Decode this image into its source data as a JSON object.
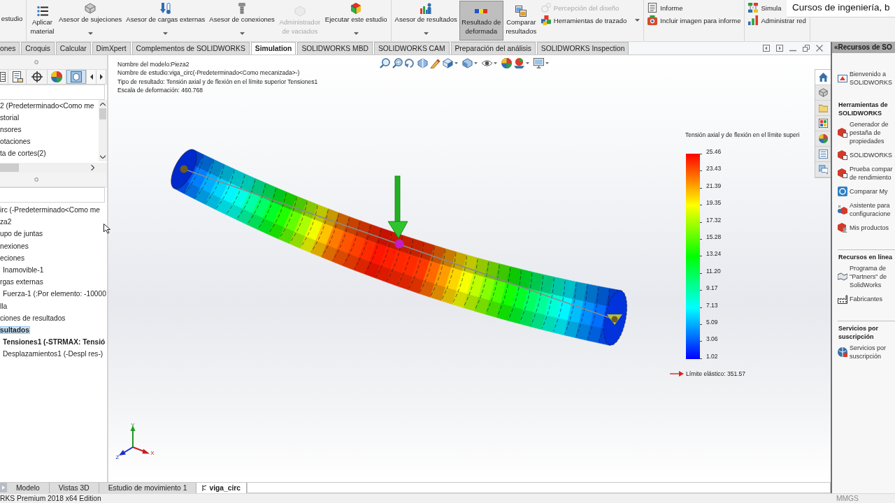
{
  "ribbon": {
    "groups": [
      {
        "items": [
          {
            "kind": "large",
            "label": "estudio",
            "menu": false,
            "selected": false,
            "disabled": false
          }
        ]
      },
      {
        "items": [
          {
            "kind": "large",
            "label": "Aplicar material",
            "menu": false,
            "selected": false,
            "disabled": false
          },
          {
            "kind": "large",
            "label": "Asesor de sujeciones",
            "menu": true,
            "selected": false,
            "disabled": false
          },
          {
            "kind": "large",
            "label": "Asesor de cargas externas",
            "menu": true,
            "selected": false,
            "disabled": false
          },
          {
            "kind": "large",
            "label": "Asesor de conexiones",
            "menu": true,
            "selected": false,
            "disabled": false
          },
          {
            "kind": "large",
            "label": "Administrador de vaciados",
            "menu": false,
            "selected": false,
            "disabled": true
          },
          {
            "kind": "large",
            "label": "Ejecutar este estudio",
            "menu": true,
            "selected": false,
            "disabled": false
          }
        ]
      },
      {
        "items": [
          {
            "kind": "large",
            "label": "Asesor de resultados",
            "menu": true,
            "selected": false,
            "disabled": false
          },
          {
            "kind": "large",
            "label": "Resultado de deformada",
            "menu": false,
            "selected": true,
            "disabled": false
          },
          {
            "kind": "large",
            "label": "Comparar resultados",
            "menu": false,
            "selected": false,
            "disabled": false
          },
          {
            "kind": "small",
            "label": "Percepción del diseño",
            "menu": false,
            "selected": false,
            "disabled": true
          },
          {
            "kind": "small",
            "label": "Herramientas de trazado",
            "menu": true,
            "selected": false,
            "disabled": false
          }
        ]
      },
      {
        "items": [
          {
            "kind": "small",
            "label": "Informe",
            "menu": false,
            "selected": false,
            "disabled": false
          },
          {
            "kind": "small",
            "label": "Incluir imagen para informe",
            "menu": false,
            "selected": false,
            "disabled": false
          }
        ]
      },
      {
        "items": [
          {
            "kind": "small",
            "label": "Simula",
            "menu": false,
            "selected": false,
            "disabled": false
          },
          {
            "kind": "small",
            "label": "Administrar red",
            "menu": false,
            "selected": false,
            "disabled": false
          }
        ]
      }
    ]
  },
  "caption": "Cursos de ingeniería, b",
  "tabs": [
    {
      "label": "ones",
      "selected": false
    },
    {
      "label": "Croquis",
      "selected": false
    },
    {
      "label": "Calcular",
      "selected": false
    },
    {
      "label": "DimXpert",
      "selected": false
    },
    {
      "label": "Complementos de SOLIDWORKS",
      "selected": false
    },
    {
      "label": "Simulation",
      "selected": true
    },
    {
      "label": "SOLIDWORKS MBD",
      "selected": false
    },
    {
      "label": "SOLIDWORKS CAM",
      "selected": false
    },
    {
      "label": "Preparación del análisis",
      "selected": false
    },
    {
      "label": "SOLIDWORKS Inspection",
      "selected": false
    }
  ],
  "feature_panel": {
    "view_tabs": [
      {
        "selected": false
      },
      {
        "selected": false
      },
      {
        "selected": false
      },
      {
        "selected": false
      },
      {
        "selected": true
      }
    ],
    "tree_top": [
      {
        "label": "2 (Predeterminado<Como me",
        "selected": false
      },
      {
        "label": "storial",
        "selected": false
      },
      {
        "label": "nsores",
        "selected": false
      },
      {
        "label": "otaciones",
        "selected": false
      },
      {
        "label": "ta de cortes(2)",
        "selected": false
      }
    ],
    "tree_bottom": [
      {
        "label": "irc (-Predeterminado<Como me",
        "selected": false,
        "active": false
      },
      {
        "label": "za2",
        "selected": false,
        "active": false
      },
      {
        "label": "upo de juntas",
        "selected": false,
        "active": false
      },
      {
        "label": "nexiones",
        "selected": false,
        "active": false
      },
      {
        "label": "eciones",
        "selected": false,
        "active": false,
        "children": [
          {
            "label": "Inamovible-1",
            "selected": false,
            "active": false
          }
        ]
      },
      {
        "label": "rgas externas",
        "selected": false,
        "active": false,
        "children": [
          {
            "label": "Fuerza-1 (:Por elemento: -10000",
            "selected": false,
            "active": false
          }
        ]
      },
      {
        "label": "lla",
        "selected": false,
        "active": false
      },
      {
        "label": "ciones de resultados",
        "selected": false,
        "active": false
      },
      {
        "label": "sultados",
        "selected": true,
        "active": true,
        "children": [
          {
            "label": "Tensiones1 (-STRMAX: Tensió",
            "selected": false,
            "active": true
          },
          {
            "label": "Desplazamientos1 (-Despl res-)",
            "selected": false,
            "active": false
          }
        ]
      }
    ]
  },
  "viewport": {
    "info": [
      "Nombre del modelo:Pieza2",
      "Nombre de estudio:viga_circ(-Predeterminado<Como mecanizada>-)",
      "Tipo de resultado: Tensión axial y de flexión en el límite superior Tensiones1",
      "Escala de deformación: 460.768"
    ],
    "legend": {
      "title": "Tensión axial y de flexión en el límite superi",
      "values": [
        "25.46",
        "23.43",
        "21.39",
        "19.35",
        "17.32",
        "15.28",
        "13.24",
        "11.20",
        "9.17",
        "7.13",
        "5.09",
        "3.06",
        "1.02"
      ],
      "yield_label": "Límite elástico: 351.57"
    },
    "triad": {
      "labels": [
        "Y",
        "X",
        "Z"
      ]
    },
    "task_tabs": [
      {
        "selected": true
      },
      {
        "selected": false
      },
      {
        "selected": false
      },
      {
        "selected": false
      },
      {
        "selected": false
      },
      {
        "selected": false
      },
      {
        "selected": false
      }
    ]
  },
  "resources": {
    "title": "«Recursos de SO",
    "sections": [
      {
        "items": [
          {
            "label": "Bienvenido a SOLIDWORKS"
          }
        ]
      },
      {
        "heading": "Herramientas de SOLIDWORKS",
        "items": [
          {
            "label": "Generador de pestaña de propiedades"
          },
          {
            "label": "SOLIDWORKS"
          },
          {
            "label": "Prueba compar de rendimiento"
          },
          {
            "label": "Comparar My"
          },
          {
            "label": "Asistente para configuracione"
          },
          {
            "label": "Mis productos"
          }
        ]
      },
      {
        "heading": "Recursos en línea",
        "items": [
          {
            "label": "Programa de \"Partners\" de SolidWorks"
          },
          {
            "label": "Fabricantes"
          }
        ]
      },
      {
        "heading": "Servicios por suscripción",
        "items": [
          {
            "label": "Servicios por suscripción"
          }
        ]
      }
    ]
  },
  "bottom_tabs": [
    {
      "label": "Modelo",
      "kind": "view",
      "selected": false
    },
    {
      "label": "Vistas 3D",
      "kind": "view",
      "selected": false
    },
    {
      "label": "Estudio de movimiento 1",
      "kind": "view",
      "selected": false
    },
    {
      "label": "viga_circ",
      "kind": "study",
      "selected": true
    }
  ],
  "status_bar": {
    "text": "RKS Premium 2018 x64 Edition",
    "units": "MMGS"
  }
}
